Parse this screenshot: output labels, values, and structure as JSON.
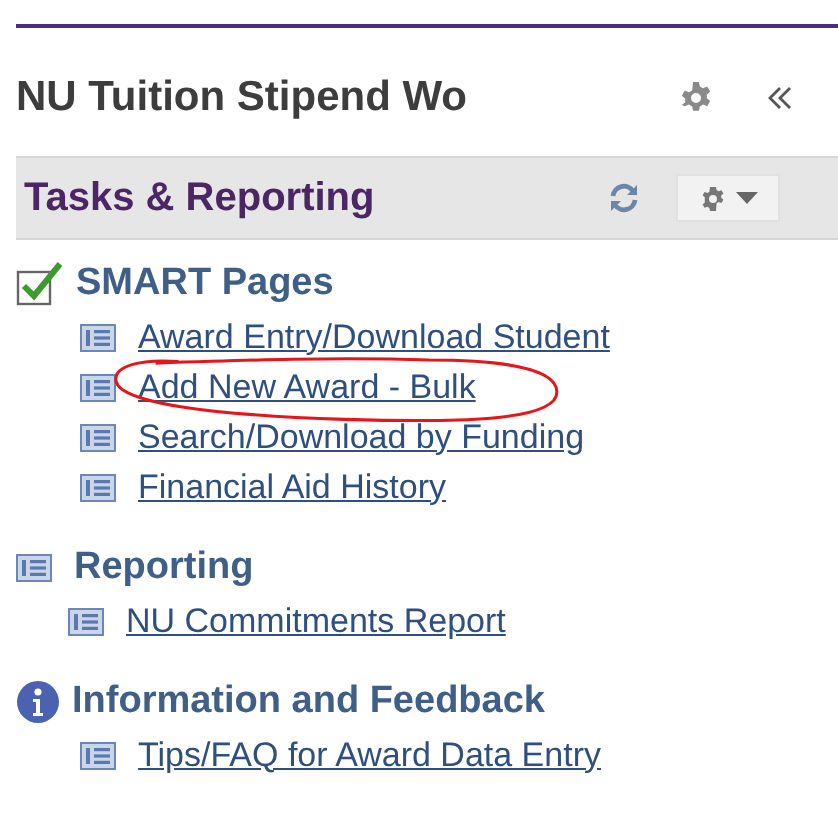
{
  "header": {
    "title": "NU Tuition Stipend Wo"
  },
  "panel": {
    "title": "Tasks & Reporting"
  },
  "sections": [
    {
      "kind": "check",
      "title": "SMART Pages",
      "items": [
        {
          "label": "Award Entry/Download Student",
          "circled": false
        },
        {
          "label": "Add New Award - Bulk",
          "circled": true
        },
        {
          "label": "Search/Download by Funding",
          "circled": false
        },
        {
          "label": "Financial Aid History",
          "circled": false
        }
      ]
    },
    {
      "kind": "list",
      "title": "Reporting",
      "items": [
        {
          "label": "NU Commitments Report",
          "circled": false
        }
      ]
    },
    {
      "kind": "info",
      "title": "Information and Feedback",
      "items": [
        {
          "label": "Tips/FAQ for Award Data Entry",
          "circled": false
        }
      ]
    }
  ]
}
